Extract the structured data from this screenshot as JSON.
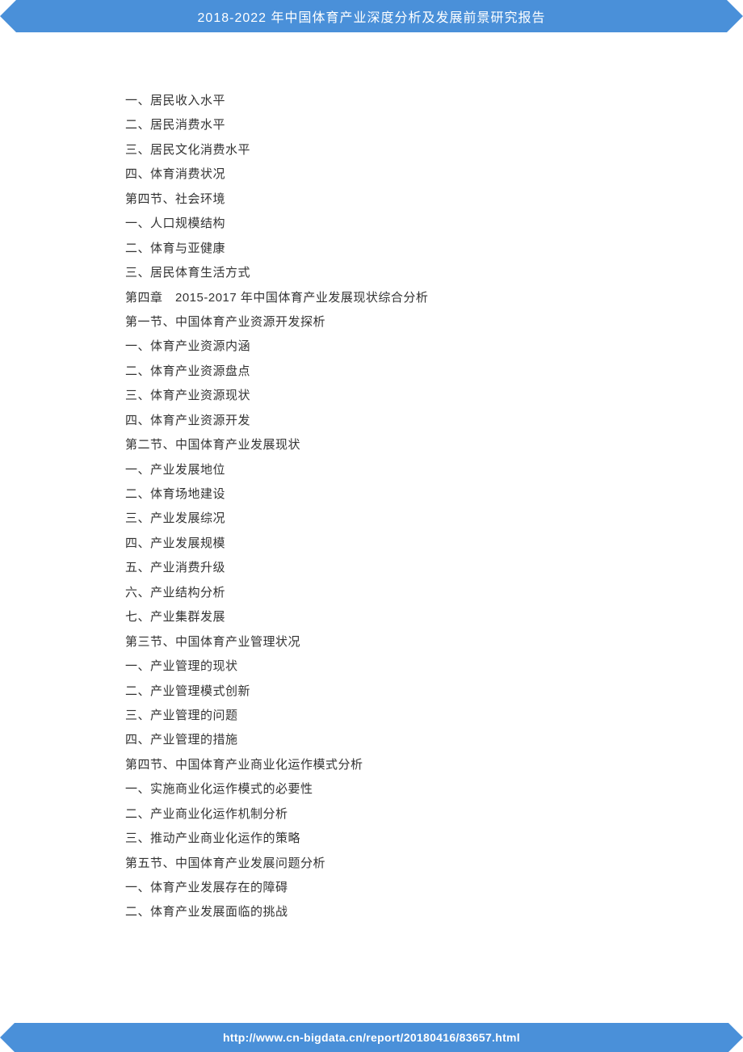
{
  "header": {
    "title": "2018-2022 年中国体育产业深度分析及发展前景研究报告"
  },
  "toc": {
    "lines": [
      "一、居民收入水平",
      "二、居民消费水平",
      "三、居民文化消费水平",
      "四、体育消费状况",
      "第四节、社会环境",
      "一、人口规模结构",
      "二、体育与亚健康",
      "三、居民体育生活方式",
      "第四章　2015-2017 年中国体育产业发展现状综合分析",
      "第一节、中国体育产业资源开发探析",
      "一、体育产业资源内涵",
      "二、体育产业资源盘点",
      "三、体育产业资源现状",
      "四、体育产业资源开发",
      "第二节、中国体育产业发展现状",
      "一、产业发展地位",
      "二、体育场地建设",
      "三、产业发展综况",
      "四、产业发展规模",
      "五、产业消费升级",
      "六、产业结构分析",
      "七、产业集群发展",
      "第三节、中国体育产业管理状况",
      "一、产业管理的现状",
      "二、产业管理模式创新",
      "三、产业管理的问题",
      "四、产业管理的措施",
      "第四节、中国体育产业商业化运作模式分析",
      "一、实施商业化运作模式的必要性",
      "二、产业商业化运作机制分析",
      "三、推动产业商业化运作的策略",
      "第五节、中国体育产业发展问题分析",
      "一、体育产业发展存在的障碍",
      "二、体育产业发展面临的挑战"
    ]
  },
  "footer": {
    "url": "http://www.cn-bigdata.cn/report/20180416/83657.html"
  }
}
